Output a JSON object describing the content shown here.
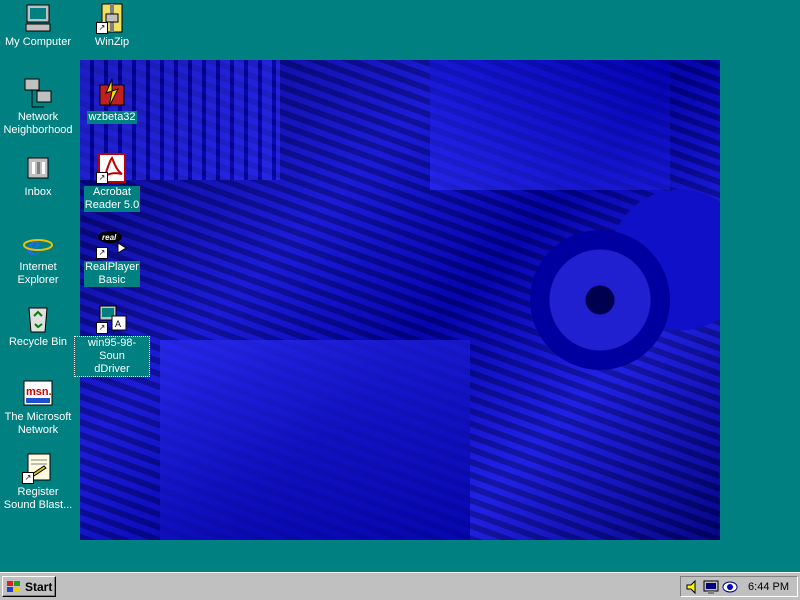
{
  "desktop": {
    "left_icons": [
      {
        "label": "My Computer",
        "icon": "my-computer-icon"
      },
      {
        "label": "Network\nNeighborhood",
        "icon": "network-neighborhood-icon"
      },
      {
        "label": "Inbox",
        "icon": "inbox-icon"
      },
      {
        "label": "Internet\nExplorer",
        "icon": "internet-explorer-icon"
      },
      {
        "label": "Recycle Bin",
        "icon": "recycle-bin-icon"
      },
      {
        "label": "The Microsoft\nNetwork",
        "icon": "msn-icon"
      },
      {
        "label": "Register\nSound Blast...",
        "icon": "register-soundblaster-icon"
      }
    ],
    "top_icons": [
      {
        "label": "WinZip",
        "icon": "winzip-icon"
      }
    ],
    "wallpaper_icons": [
      {
        "label": "wzbeta32",
        "icon": "wzbeta32-icon"
      },
      {
        "label": "Acrobat\nReader 5.0",
        "icon": "acrobat-reader-icon"
      },
      {
        "label": "RealPlayer\nBasic",
        "icon": "realplayer-icon"
      },
      {
        "label": "win95-98-Soun\ndDriver",
        "icon": "sound-driver-icon"
      }
    ],
    "colors": {
      "desktop": "#008080",
      "wallpaper": "#1a1ad0"
    }
  },
  "taskbar": {
    "start_label": "Start",
    "tray_icons": [
      "volume-icon",
      "display-icon",
      "eye-icon"
    ],
    "clock": "6:44 PM"
  }
}
